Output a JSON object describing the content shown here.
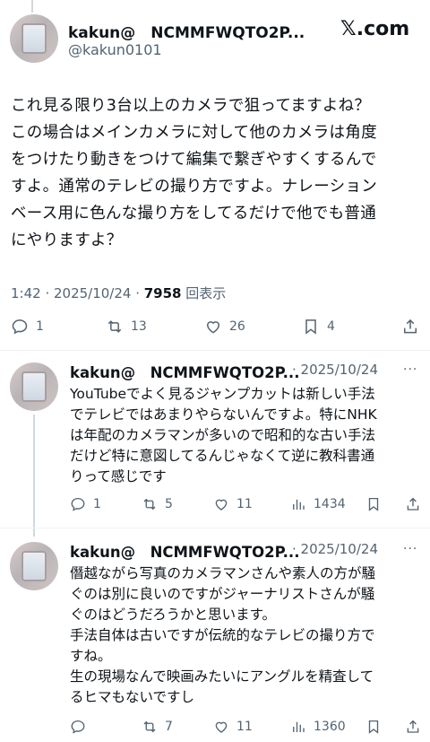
{
  "brand": {
    "logo_label": "𝕏.com"
  },
  "main_tweet": {
    "name": "kakun@　NCMMFWQTO2P...",
    "handle": "@kakun0101",
    "text_lines": [
      "これ見る限り3台以上のカメラで狙ってますよね？",
      "この場合はメインカメラに対して他のカメラは角度",
      "をつけたり動きをつけて編集で繋ぎやすくするんで",
      "すよ。通常のテレビの撮り方ですよ。ナレーション",
      "ベース用に色んな撮り方をしてるだけで他でも普通",
      "にやりますよ？"
    ],
    "time": "1:42 · 2025/10/24 · ",
    "views": "7958",
    "views_label": " 回表示",
    "replies": "1",
    "reposts": "13",
    "likes": "26",
    "bookmarks": "4"
  },
  "replies": [
    {
      "name": "kakun@　NCMMFWQTO2P...",
      "date": "· 2025/10/24",
      "text_lines": [
        "YouTubeでよく見るジャンプカットは新しい手法",
        "でテレビではあまりやらないんですよ。特にNHK",
        "は年配のカメラマンが多いので昭和的な古い手法",
        "だけど特に意図してるんじゃなくて逆に教科書通",
        "りって感じです"
      ],
      "replies": "1",
      "reposts": "5",
      "likes": "11",
      "views": "1434"
    },
    {
      "name": "kakun@　NCMMFWQTO2P...",
      "date": "· 2025/10/24",
      "text_lines": [
        "僭越ながら写真のカメラマンさんや素人の方が騒",
        "ぐのは別に良いのですがジャーナリストさんが騒",
        "ぐのはどうだろうかと思います。",
        "手法自体は古いですが伝統的なテレビの撮り方で",
        "すね。",
        "生の現場なんで映画みたいにアングルを精査して",
        "るヒマもないですし"
      ],
      "replies": "",
      "reposts": "7",
      "likes": "11",
      "views": "1360"
    }
  ]
}
